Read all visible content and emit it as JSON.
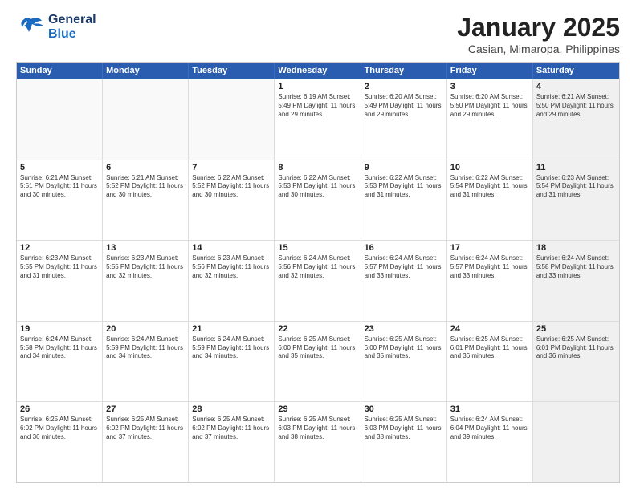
{
  "header": {
    "logo_general": "General",
    "logo_blue": "Blue",
    "title": "January 2025",
    "subtitle": "Casian, Mimaropa, Philippines"
  },
  "weekdays": [
    "Sunday",
    "Monday",
    "Tuesday",
    "Wednesday",
    "Thursday",
    "Friday",
    "Saturday"
  ],
  "rows": [
    [
      {
        "day": "",
        "text": "",
        "empty": true
      },
      {
        "day": "",
        "text": "",
        "empty": true
      },
      {
        "day": "",
        "text": "",
        "empty": true
      },
      {
        "day": "1",
        "text": "Sunrise: 6:19 AM\nSunset: 5:49 PM\nDaylight: 11 hours\nand 29 minutes."
      },
      {
        "day": "2",
        "text": "Sunrise: 6:20 AM\nSunset: 5:49 PM\nDaylight: 11 hours\nand 29 minutes."
      },
      {
        "day": "3",
        "text": "Sunrise: 6:20 AM\nSunset: 5:50 PM\nDaylight: 11 hours\nand 29 minutes."
      },
      {
        "day": "4",
        "text": "Sunrise: 6:21 AM\nSunset: 5:50 PM\nDaylight: 11 hours\nand 29 minutes.",
        "shaded": true
      }
    ],
    [
      {
        "day": "5",
        "text": "Sunrise: 6:21 AM\nSunset: 5:51 PM\nDaylight: 11 hours\nand 30 minutes."
      },
      {
        "day": "6",
        "text": "Sunrise: 6:21 AM\nSunset: 5:52 PM\nDaylight: 11 hours\nand 30 minutes."
      },
      {
        "day": "7",
        "text": "Sunrise: 6:22 AM\nSunset: 5:52 PM\nDaylight: 11 hours\nand 30 minutes."
      },
      {
        "day": "8",
        "text": "Sunrise: 6:22 AM\nSunset: 5:53 PM\nDaylight: 11 hours\nand 30 minutes."
      },
      {
        "day": "9",
        "text": "Sunrise: 6:22 AM\nSunset: 5:53 PM\nDaylight: 11 hours\nand 31 minutes."
      },
      {
        "day": "10",
        "text": "Sunrise: 6:22 AM\nSunset: 5:54 PM\nDaylight: 11 hours\nand 31 minutes."
      },
      {
        "day": "11",
        "text": "Sunrise: 6:23 AM\nSunset: 5:54 PM\nDaylight: 11 hours\nand 31 minutes.",
        "shaded": true
      }
    ],
    [
      {
        "day": "12",
        "text": "Sunrise: 6:23 AM\nSunset: 5:55 PM\nDaylight: 11 hours\nand 31 minutes."
      },
      {
        "day": "13",
        "text": "Sunrise: 6:23 AM\nSunset: 5:55 PM\nDaylight: 11 hours\nand 32 minutes."
      },
      {
        "day": "14",
        "text": "Sunrise: 6:23 AM\nSunset: 5:56 PM\nDaylight: 11 hours\nand 32 minutes."
      },
      {
        "day": "15",
        "text": "Sunrise: 6:24 AM\nSunset: 5:56 PM\nDaylight: 11 hours\nand 32 minutes."
      },
      {
        "day": "16",
        "text": "Sunrise: 6:24 AM\nSunset: 5:57 PM\nDaylight: 11 hours\nand 33 minutes."
      },
      {
        "day": "17",
        "text": "Sunrise: 6:24 AM\nSunset: 5:57 PM\nDaylight: 11 hours\nand 33 minutes."
      },
      {
        "day": "18",
        "text": "Sunrise: 6:24 AM\nSunset: 5:58 PM\nDaylight: 11 hours\nand 33 minutes.",
        "shaded": true
      }
    ],
    [
      {
        "day": "19",
        "text": "Sunrise: 6:24 AM\nSunset: 5:58 PM\nDaylight: 11 hours\nand 34 minutes."
      },
      {
        "day": "20",
        "text": "Sunrise: 6:24 AM\nSunset: 5:59 PM\nDaylight: 11 hours\nand 34 minutes."
      },
      {
        "day": "21",
        "text": "Sunrise: 6:24 AM\nSunset: 5:59 PM\nDaylight: 11 hours\nand 34 minutes."
      },
      {
        "day": "22",
        "text": "Sunrise: 6:25 AM\nSunset: 6:00 PM\nDaylight: 11 hours\nand 35 minutes."
      },
      {
        "day": "23",
        "text": "Sunrise: 6:25 AM\nSunset: 6:00 PM\nDaylight: 11 hours\nand 35 minutes."
      },
      {
        "day": "24",
        "text": "Sunrise: 6:25 AM\nSunset: 6:01 PM\nDaylight: 11 hours\nand 36 minutes."
      },
      {
        "day": "25",
        "text": "Sunrise: 6:25 AM\nSunset: 6:01 PM\nDaylight: 11 hours\nand 36 minutes.",
        "shaded": true
      }
    ],
    [
      {
        "day": "26",
        "text": "Sunrise: 6:25 AM\nSunset: 6:02 PM\nDaylight: 11 hours\nand 36 minutes."
      },
      {
        "day": "27",
        "text": "Sunrise: 6:25 AM\nSunset: 6:02 PM\nDaylight: 11 hours\nand 37 minutes."
      },
      {
        "day": "28",
        "text": "Sunrise: 6:25 AM\nSunset: 6:02 PM\nDaylight: 11 hours\nand 37 minutes."
      },
      {
        "day": "29",
        "text": "Sunrise: 6:25 AM\nSunset: 6:03 PM\nDaylight: 11 hours\nand 38 minutes."
      },
      {
        "day": "30",
        "text": "Sunrise: 6:25 AM\nSunset: 6:03 PM\nDaylight: 11 hours\nand 38 minutes."
      },
      {
        "day": "31",
        "text": "Sunrise: 6:24 AM\nSunset: 6:04 PM\nDaylight: 11 hours\nand 39 minutes."
      },
      {
        "day": "",
        "text": "",
        "empty": true,
        "shaded": true
      }
    ]
  ]
}
